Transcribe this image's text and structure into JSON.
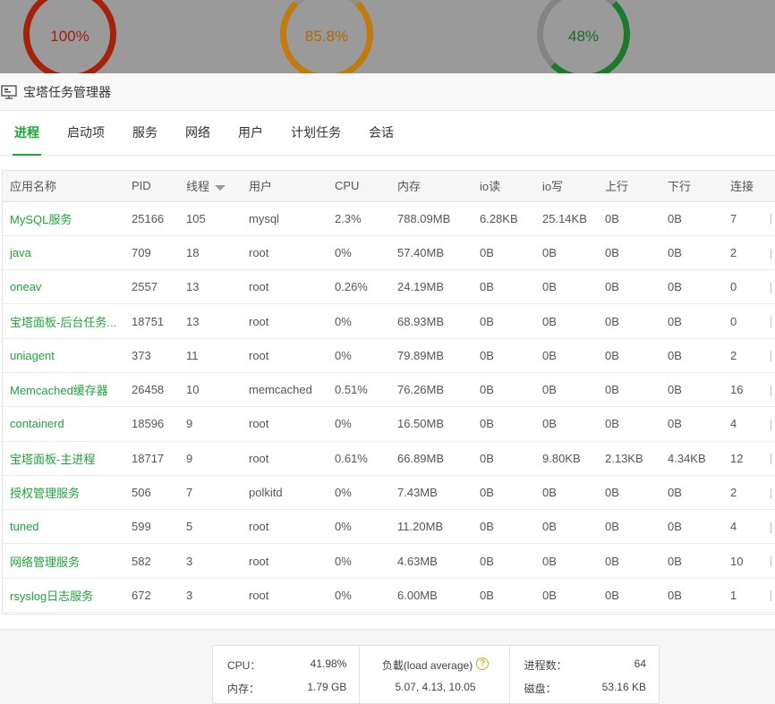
{
  "gauges": [
    {
      "value": "100%"
    },
    {
      "value": "85.8%"
    },
    {
      "value": "48%"
    }
  ],
  "dialog": {
    "title": "宝塔任务管理器",
    "icon": "monitor-icon"
  },
  "tabs": [
    {
      "label": "进程",
      "active": true
    },
    {
      "label": "启动项",
      "active": false
    },
    {
      "label": "服务",
      "active": false
    },
    {
      "label": "网络",
      "active": false
    },
    {
      "label": "用户",
      "active": false
    },
    {
      "label": "计划任务",
      "active": false
    },
    {
      "label": "会话",
      "active": false
    }
  ],
  "table": {
    "headers": [
      "应用名称",
      "PID",
      "线程",
      "用户",
      "CPU",
      "内存",
      "io读",
      "io写",
      "上行",
      "下行",
      "连接"
    ],
    "rows": [
      [
        "MySQL服务",
        "25166",
        "105",
        "mysql",
        "2.3%",
        "788.09MB",
        "6.28KB",
        "25.14KB",
        "0B",
        "0B",
        "7"
      ],
      [
        "java",
        "709",
        "18",
        "root",
        "0%",
        "57.40MB",
        "0B",
        "0B",
        "0B",
        "0B",
        "2"
      ],
      [
        "oneav",
        "2557",
        "13",
        "root",
        "0.26%",
        "24.19MB",
        "0B",
        "0B",
        "0B",
        "0B",
        "0"
      ],
      [
        "宝塔面板-后台任务...",
        "18751",
        "13",
        "root",
        "0%",
        "68.93MB",
        "0B",
        "0B",
        "0B",
        "0B",
        "0"
      ],
      [
        "uniagent",
        "373",
        "11",
        "root",
        "0%",
        "79.89MB",
        "0B",
        "0B",
        "0B",
        "0B",
        "2"
      ],
      [
        "Memcached缓存器",
        "26458",
        "10",
        "memcached",
        "0.51%",
        "76.26MB",
        "0B",
        "0B",
        "0B",
        "0B",
        "16"
      ],
      [
        "containerd",
        "18596",
        "9",
        "root",
        "0%",
        "16.50MB",
        "0B",
        "0B",
        "0B",
        "0B",
        "4"
      ],
      [
        "宝塔面板-主进程",
        "18717",
        "9",
        "root",
        "0.61%",
        "66.89MB",
        "0B",
        "9.80KB",
        "2.13KB",
        "4.34KB",
        "12"
      ],
      [
        "授权管理服务",
        "506",
        "7",
        "polkitd",
        "0%",
        "7.43MB",
        "0B",
        "0B",
        "0B",
        "0B",
        "2"
      ],
      [
        "tuned",
        "599",
        "5",
        "root",
        "0%",
        "11.20MB",
        "0B",
        "0B",
        "0B",
        "0B",
        "4"
      ],
      [
        "网络管理服务",
        "582",
        "3",
        "root",
        "0%",
        "4.63MB",
        "0B",
        "0B",
        "0B",
        "0B",
        "10"
      ],
      [
        "rsyslog日志服务",
        "672",
        "3",
        "root",
        "0%",
        "6.00MB",
        "0B",
        "0B",
        "0B",
        "0B",
        "1"
      ]
    ]
  },
  "stats": {
    "cpu_label": "CPU：",
    "cpu_value": "41.98%",
    "mem_label": "内存：",
    "mem_value": "1.79 GB",
    "load_label": "负載(load average)",
    "load_value": "5.07, 4.13, 10.05",
    "proc_label": "进程数：",
    "proc_value": "64",
    "disk_label": "磁盘：",
    "disk_value": "53.16 KB"
  },
  "colors": {
    "accent": "#20a53a",
    "gauge_red": "#a4220b",
    "gauge_orange": "#c07a0d",
    "gauge_green": "#1c7a2b"
  }
}
